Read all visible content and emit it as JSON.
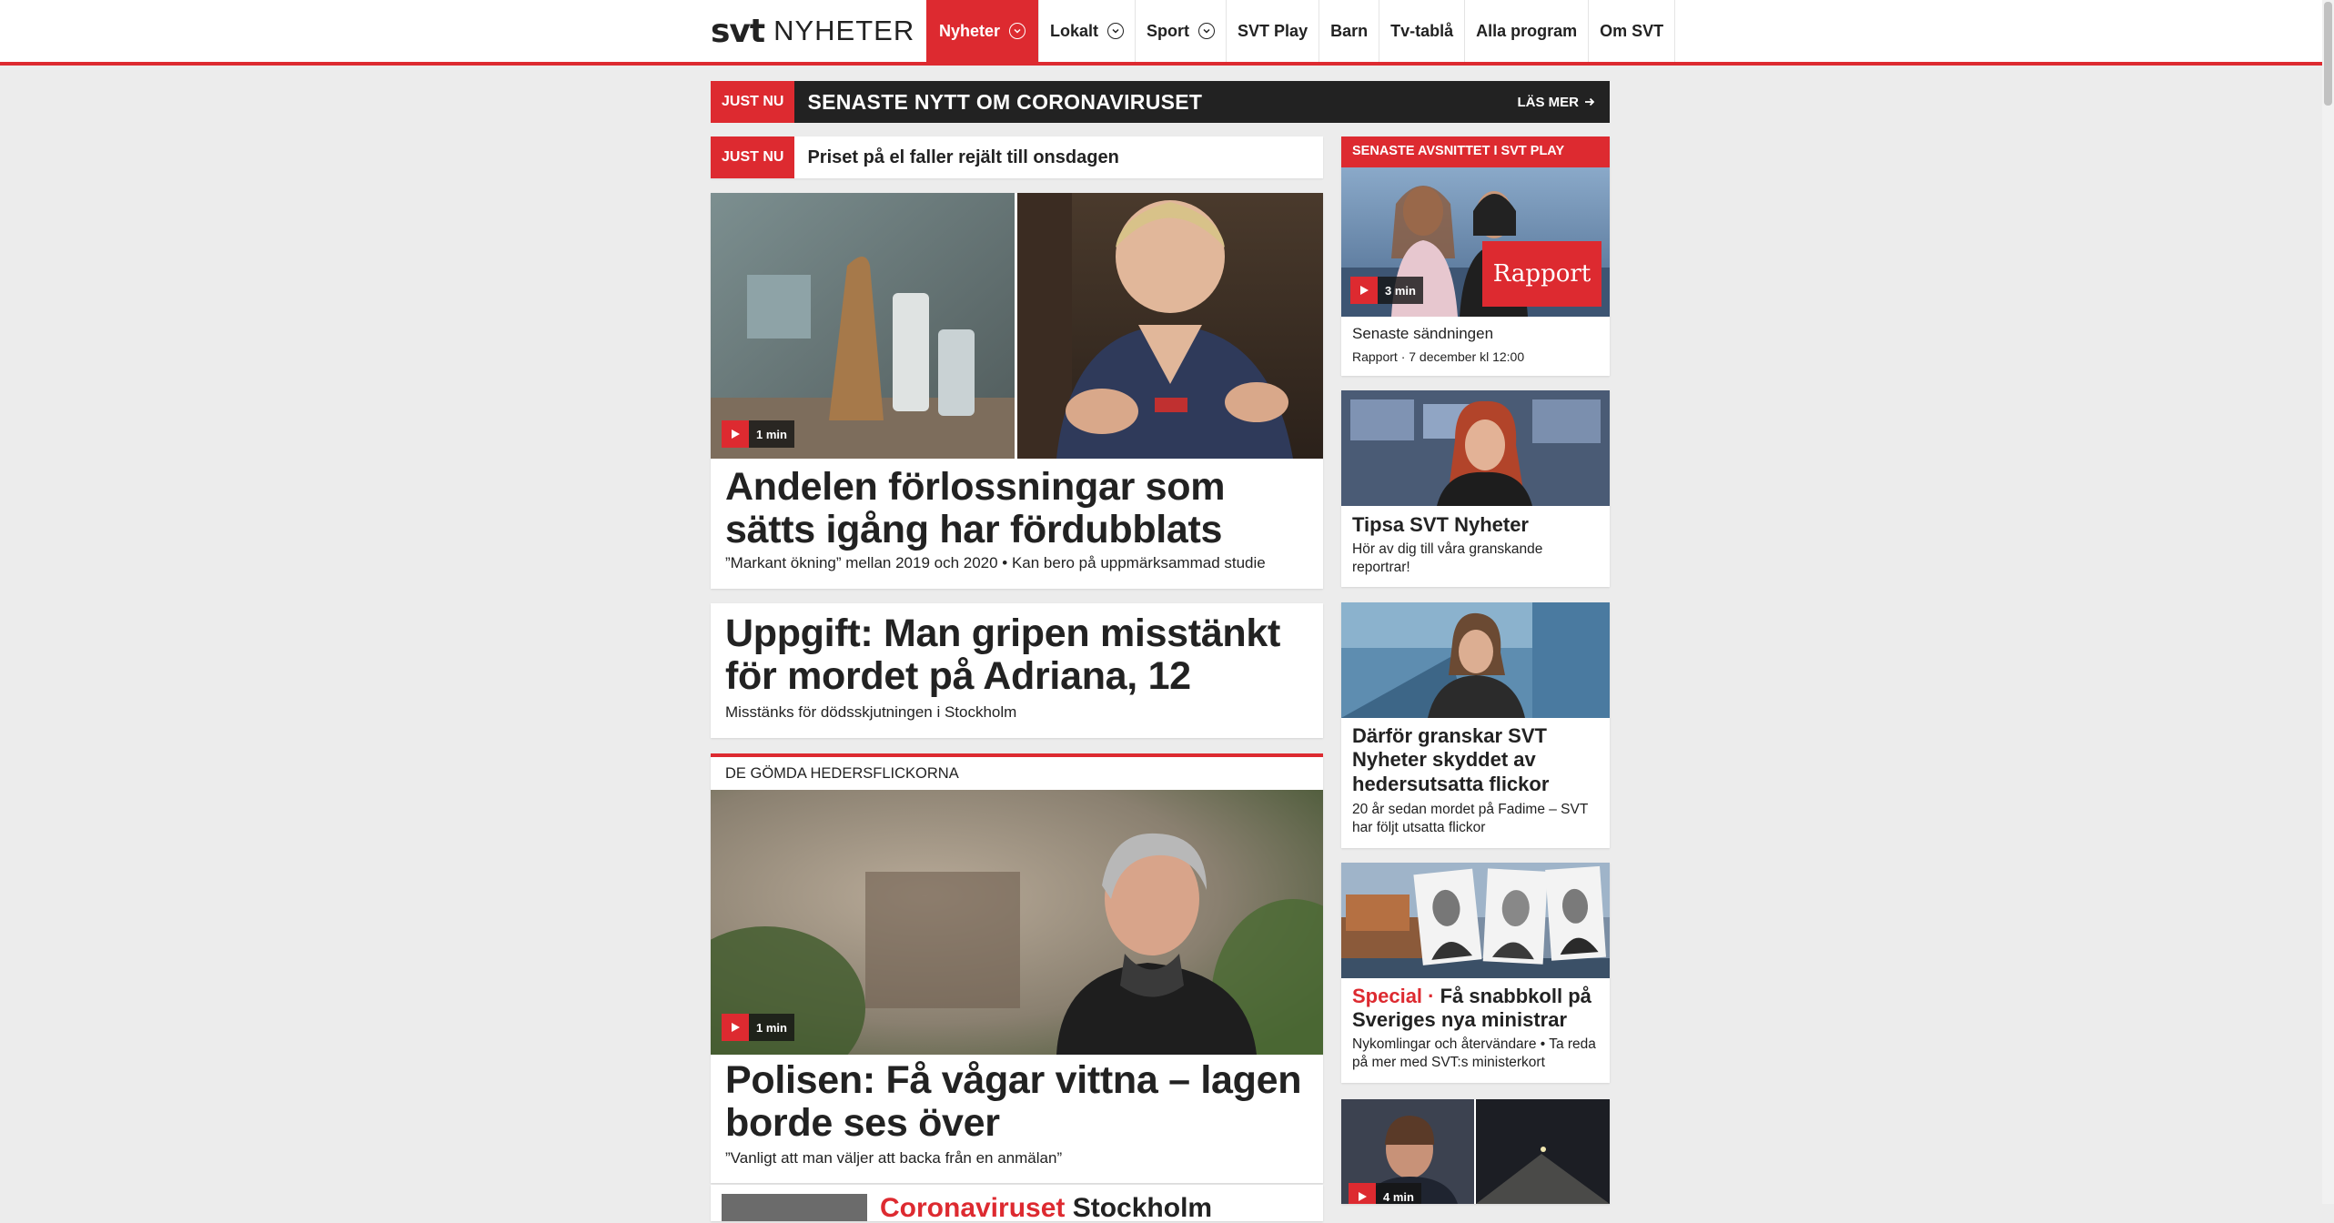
{
  "header": {
    "logo": {
      "brand": "svt",
      "section": "NYHETER"
    },
    "nav": [
      {
        "label": "Nyheter",
        "active": true,
        "dropdown": true
      },
      {
        "label": "Lokalt",
        "active": false,
        "dropdown": true
      },
      {
        "label": "Sport",
        "active": false,
        "dropdown": true
      },
      {
        "label": "SVT Play",
        "active": false,
        "dropdown": false
      },
      {
        "label": "Barn",
        "active": false,
        "dropdown": false
      },
      {
        "label": "Tv-tablå",
        "active": false,
        "dropdown": false
      },
      {
        "label": "Alla program",
        "active": false,
        "dropdown": false
      },
      {
        "label": "Om SVT",
        "active": false,
        "dropdown": false
      }
    ]
  },
  "banner": {
    "tag": "JUST NU",
    "title": "SENASTE NYTT OM CORONAVIRUSET",
    "more": "LÄS MER"
  },
  "breaking": {
    "tag": "JUST NU",
    "text": "Priset på el faller rejält till onsdagen"
  },
  "stories": [
    {
      "duration": "1 min",
      "title": "Andelen förlossningar som sätts igång har fördubblats",
      "sub": "”Markant ökning” mellan 2019 och 2020 • Kan bero på uppmärksammad studie"
    },
    {
      "title": "Uppgift: Man gripen misstänkt för mordet på Adriana, 12",
      "sub": "Misstänks för dödsskjutningen i Stockholm"
    },
    {
      "label": "DE GÖMDA HEDERSFLICKORNA",
      "duration": "1 min",
      "title": "Polisen: Få vågar vittna – lagen borde ses över",
      "sub": "”Vanligt att man väljer att backa från en anmälan”"
    },
    {
      "kicker": "Coronaviruset",
      "title": "Stockholm"
    }
  ],
  "sidebar": {
    "play_header": "SENASTE AVSNITTET I SVT PLAY",
    "play_duration": "3 min",
    "play_badge": "Rapport",
    "play_title": "Senaste sändningen",
    "play_meta": "Rapport · 7 december kl 12:00",
    "tips_title": "Tipsa SVT Nyheter",
    "tips_sub": "Hör av dig till våra granskande reportrar!",
    "review_title": "Därför granskar SVT Nyheter skyddet av hedersutsatta flickor",
    "review_sub": "20 år sedan mordet på Fadime – SVT har följt utsatta flickor",
    "special_kicker": "Special ·",
    "special_title": "Få snabbkoll på Sveriges nya ministrar",
    "special_sub": "Nykomlingar och återvändare • Ta reda på mer med SVT:s ministerkort",
    "last_duration": "4 min"
  },
  "colors": {
    "accent": "#dd2a30",
    "dark": "#222222",
    "background": "#ececec"
  }
}
